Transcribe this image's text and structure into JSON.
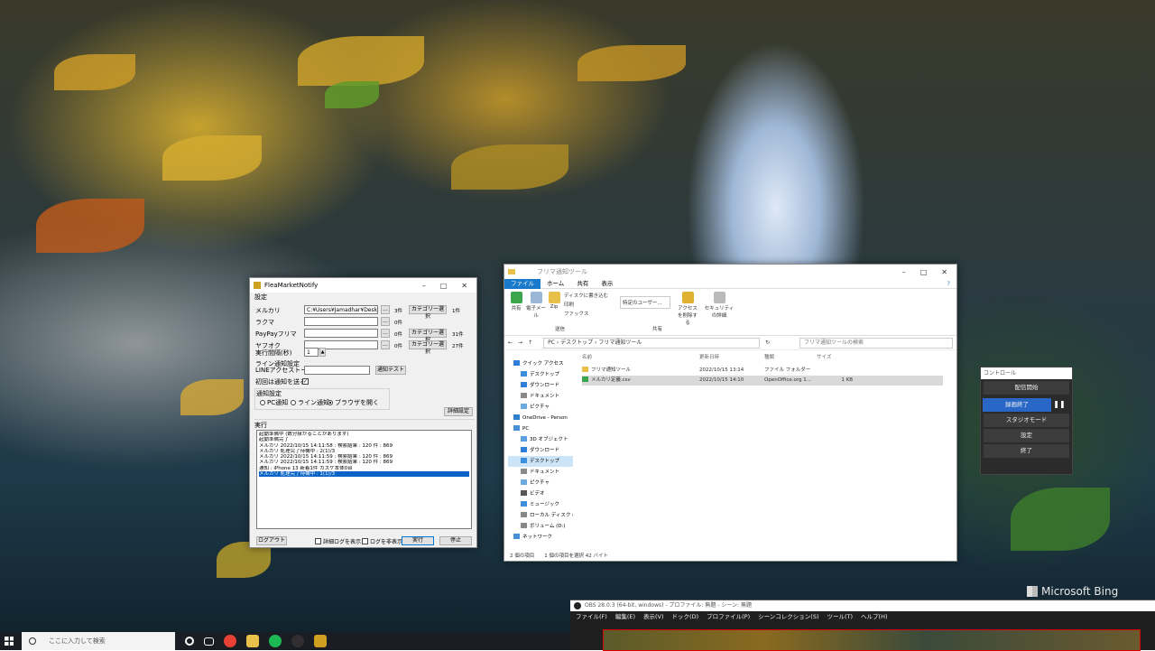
{
  "desktop": {
    "watermark": "Microsoft Bing"
  },
  "fleamarket": {
    "title": "FleaMarketNotify",
    "settings_label": "設定",
    "rows": [
      {
        "label": "メルカリ",
        "value": "C:¥Users¥Jamadhar¥Desktop¥",
        "count": "3件",
        "category_button": "カテゴリー選択",
        "category_count": "1件"
      },
      {
        "label": "ラクマ",
        "value": "",
        "count": "0件",
        "category_button": "",
        "category_count": ""
      },
      {
        "label": "PayPayフリマ",
        "value": "",
        "count": "0件",
        "category_button": "カテゴリー選択",
        "category_count": "31件"
      },
      {
        "label": "ヤフオク",
        "value": "",
        "count": "0件",
        "category_button": "カテゴリー選択",
        "category_count": "27件"
      }
    ],
    "interval_label": "実行間隔(秒)",
    "interval_value": "1",
    "line_label_1": "ライン通知設定",
    "line_label_2": "LINEアクセストークン",
    "line_test_button": "通知テスト",
    "notify_first_label": "初回は通知を送る",
    "notify_first_checked": true,
    "notify_settings_label": "通知設定",
    "notify_options": [
      "PC通知",
      "ライン通知",
      "ブラウザを開く"
    ],
    "notify_selected": 2,
    "detail_button": "詳細設定",
    "run_label": "実行",
    "log_lines": [
      "起動準備中 (数分掛かることがあります)",
      "起動準備完了",
      "メルカリ 2022/10/15 14:11:58 : 検索結果 : 120 件 : 869",
      "メルカリ 処理完了待機中 : 2(1)/3",
      "メルカリ 2022/10/15 14:11:59 : 検索結果 : 120 件 : 869",
      "メルカリ 2022/10/15 14:11:59 : 検索結果 : 120 件 : 869",
      "通知 : iPhone 13 新着1件 カスケ本体0台",
      "メルカリ 処理完了待機中 : 1(1)/3"
    ],
    "log_selected_index": 7,
    "logout_button": "ログアウト",
    "detail_log_label": "詳細ログを表示",
    "log_show_label": "ログを非表示",
    "run_button": "実行",
    "stop_button": "停止"
  },
  "explorer": {
    "title": "フリマ通知ツール",
    "ribbon_tabs": [
      "ファイル",
      "ホーム",
      "共有",
      "表示"
    ],
    "ribbon_buttons": [
      "共有",
      "電子メール",
      "Zip",
      "ディスクに書き込む",
      "印刷",
      "ファックス",
      "特定のユーザー...",
      "アクセスを削除する",
      "セキュリティの詳細"
    ],
    "ribbon_groups": [
      "送信",
      "共有"
    ],
    "breadcrumb": [
      "PC",
      "デスクトップ",
      "フリマ通知ツール"
    ],
    "search_placeholder": "フリマ通知ツールの検索",
    "nav_items": [
      {
        "label": "クイック アクセス",
        "color": "#2f7fd8",
        "sub": false,
        "active": false
      },
      {
        "label": "デスクトップ",
        "color": "#3b8fdc",
        "sub": true,
        "active": false
      },
      {
        "label": "ダウンロード",
        "color": "#2f7fd8",
        "sub": true,
        "active": false
      },
      {
        "label": "ドキュメント",
        "color": "#8a8a8a",
        "sub": true,
        "active": false
      },
      {
        "label": "ピクチャ",
        "color": "#6aa8e0",
        "sub": true,
        "active": false
      },
      {
        "label": "OneDrive - Person",
        "color": "#2d7fd0",
        "sub": false,
        "active": false
      },
      {
        "label": "PC",
        "color": "#4a90d9",
        "sub": false,
        "active": false
      },
      {
        "label": "3D オブジェクト",
        "color": "#5aa0e0",
        "sub": true,
        "active": false
      },
      {
        "label": "ダウンロード",
        "color": "#2f7fd8",
        "sub": true,
        "active": false
      },
      {
        "label": "デスクトップ",
        "color": "#3b8fdc",
        "sub": true,
        "active": true
      },
      {
        "label": "ドキュメント",
        "color": "#8a8a8a",
        "sub": true,
        "active": false
      },
      {
        "label": "ピクチャ",
        "color": "#6aa8e0",
        "sub": true,
        "active": false
      },
      {
        "label": "ビデオ",
        "color": "#555555",
        "sub": true,
        "active": false
      },
      {
        "label": "ミュージック",
        "color": "#3b8fdc",
        "sub": true,
        "active": false
      },
      {
        "label": "ローカル ディスク (C",
        "color": "#888888",
        "sub": true,
        "active": false
      },
      {
        "label": "ボリューム (D:)",
        "color": "#888888",
        "sub": true,
        "active": false
      },
      {
        "label": "ネットワーク",
        "color": "#4a90d9",
        "sub": false,
        "active": false
      }
    ],
    "columns": [
      "名前",
      "更新日時",
      "種類",
      "サイズ"
    ],
    "files": [
      {
        "name": "フリマ通知ツール",
        "date": "2022/10/15 13:14",
        "type": "ファイル フォルダー",
        "size": "",
        "icon": "#e8c04a"
      },
      {
        "name": "メルカリ定義.csv",
        "date": "2022/10/15 14:10",
        "type": "OpenOffice.org 1...",
        "size": "1 KB",
        "icon": "#3aa54a"
      }
    ],
    "selected_file": 1,
    "status": "2 個の項目　　1 個の項目を選択 42 バイト"
  },
  "obs_control": {
    "header": "コントロール",
    "start_stream": "配信開始",
    "stop_record": "録画終了",
    "pause_icon": "pause-icon",
    "studio_mode": "スタジオモード",
    "settings": "設定",
    "exit": "終了"
  },
  "obs_window": {
    "title": "OBS 28.0.3 (64-bit, windows) - プロファイル: 無題 - シーン: 無題",
    "menu": [
      "ファイル(F)",
      "編集(E)",
      "表示(V)",
      "ドック(D)",
      "プロファイル(P)",
      "シーンコレクション(S)",
      "ツール(T)",
      "ヘルプ(H)"
    ]
  },
  "taskbar": {
    "search_placeholder": "ここに入力して検索",
    "apps": [
      {
        "name": "cortana-icon",
        "color": "#1b1d24"
      },
      {
        "name": "task-view-icon",
        "color": "#1b1d24"
      },
      {
        "name": "chrome-icon",
        "color": "#e94235"
      },
      {
        "name": "file-explorer-icon",
        "color": "#e8c04a"
      },
      {
        "name": "spotify-icon",
        "color": "#1db954"
      },
      {
        "name": "obs-icon",
        "color": "#302e31"
      },
      {
        "name": "fleamarket-app-icon",
        "color": "#d0a020"
      }
    ]
  }
}
